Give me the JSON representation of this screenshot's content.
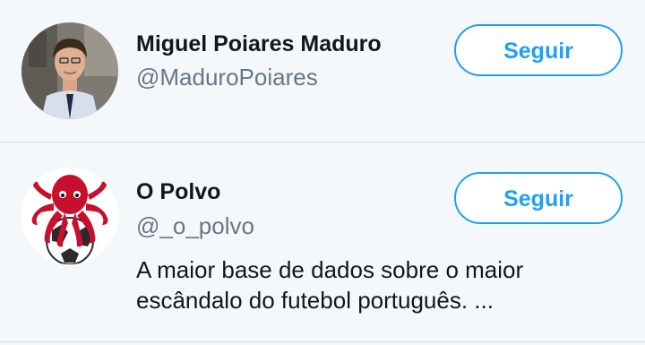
{
  "accounts": [
    {
      "name": "Miguel Poiares Maduro",
      "handle": "@MaduroPoiares",
      "follow_label": "Seguir"
    },
    {
      "name": "O Polvo",
      "handle": "@_o_polvo",
      "bio_lines": [
        "A maior base de dados sobre o maior",
        "escândalo do futebol português. ..."
      ],
      "follow_label": "Seguir"
    }
  ],
  "colors": {
    "accent": "#1da1f2",
    "background": "#f5f8fa",
    "octopus_red": "#c8102e"
  }
}
